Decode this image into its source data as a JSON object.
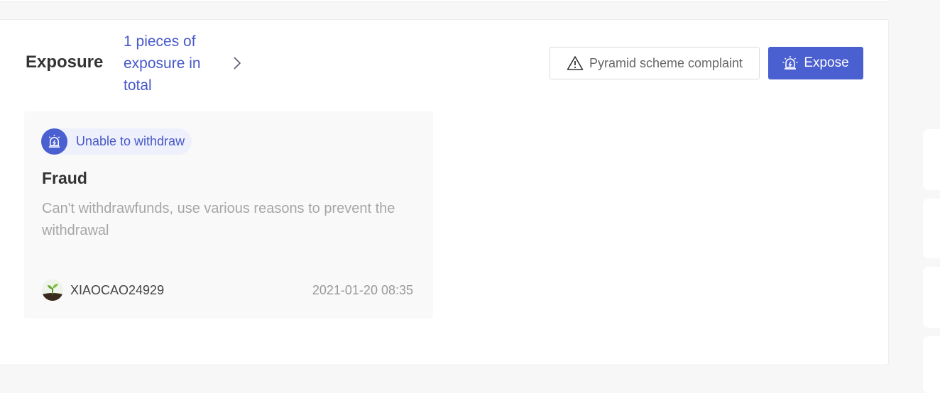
{
  "exposure": {
    "title": "Exposure",
    "count_text": "1 pieces of exposure in total",
    "complaint_button": "Pyramid scheme complaint",
    "expose_button": "Expose"
  },
  "card": {
    "tag": "Unable to withdraw",
    "title": "Fraud",
    "description": "Can't withdrawfunds, use various reasons to prevent the withdrawal",
    "author": "XIAOCAO24929",
    "date": "2021-01-20 08:35"
  },
  "icons": {
    "chevron": "chevron-right-icon",
    "complaint": "warning-triangle-icon",
    "expose": "alarm-siren-icon",
    "avatar": "sprout-avatar"
  },
  "colors": {
    "accent": "#4a5fd0",
    "link": "#4658c9",
    "muted_text": "#a6a6a6"
  }
}
